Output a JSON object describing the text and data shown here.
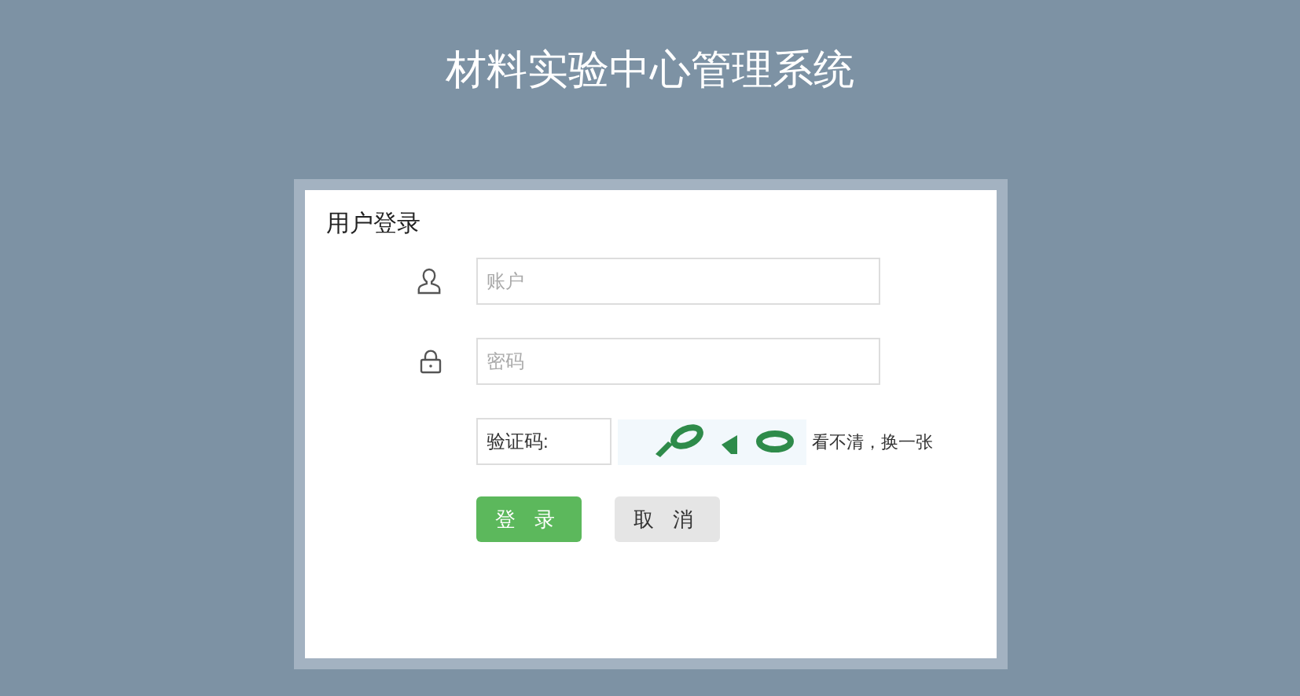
{
  "page_title": "材料实验中心管理系统",
  "login_panel": {
    "title": "用户登录",
    "fields": [
      {
        "kind": "user",
        "placeholder": "账户"
      },
      {
        "kind": "password",
        "placeholder": "密码"
      }
    ],
    "captcha": {
      "value": "验证码:",
      "refresh_link": "看不清，换一张"
    },
    "buttons": [
      {
        "kind": "primary",
        "label": "登 录"
      },
      {
        "kind": "secondary",
        "label": "取 消"
      }
    ]
  }
}
